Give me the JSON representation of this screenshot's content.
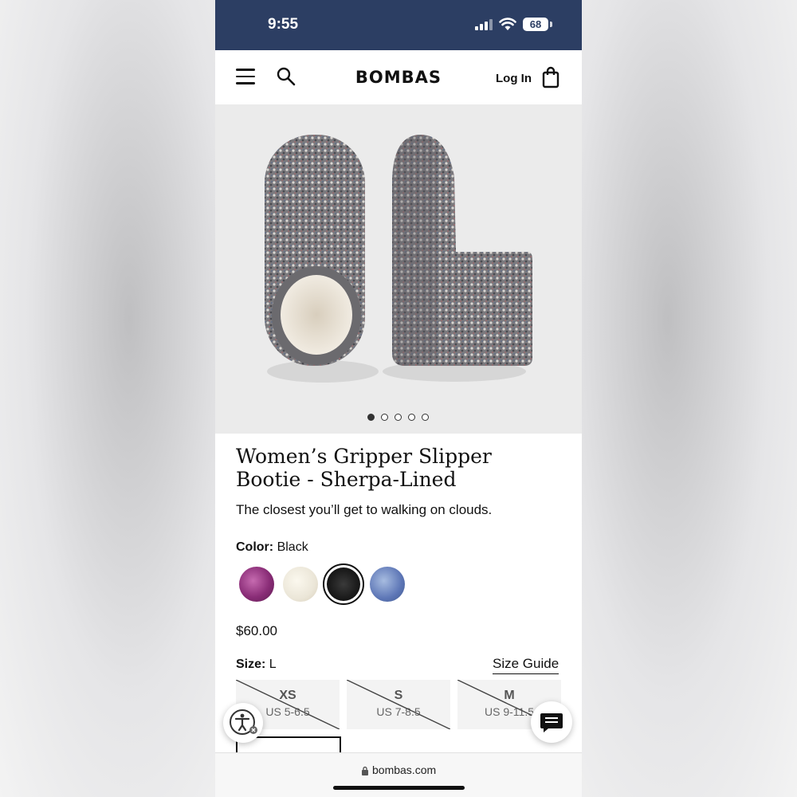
{
  "status_bar": {
    "time": "9:55",
    "battery": "68"
  },
  "header": {
    "brand": "BOMBAS",
    "login_label": "Log In"
  },
  "gallery": {
    "slide_count": 5,
    "active_slide": 1
  },
  "product": {
    "title_line1": "Women’s Gripper Slipper",
    "title_line2": "Bootie - Sherpa-Lined",
    "tagline": "The closest you’ll get to walking on clouds.",
    "color_label": "Color:",
    "color_value": "Black",
    "price": "$60.00",
    "size_label": "Size:",
    "size_value": "L",
    "size_guide": "Size Guide"
  },
  "swatches": [
    {
      "color": "#8a2d77"
    },
    {
      "color": "#ebe6d8"
    },
    {
      "color": "#151515",
      "selected": true
    },
    {
      "color": "#5d76b6"
    }
  ],
  "sizes": [
    {
      "name": "XS",
      "range": "US 5-6.5",
      "available": false
    },
    {
      "name": "S",
      "range": "US 7-8.5",
      "available": false
    },
    {
      "name": "M",
      "range": "US 9-11.5",
      "available": false
    }
  ],
  "browser": {
    "url": "bombas.com"
  }
}
